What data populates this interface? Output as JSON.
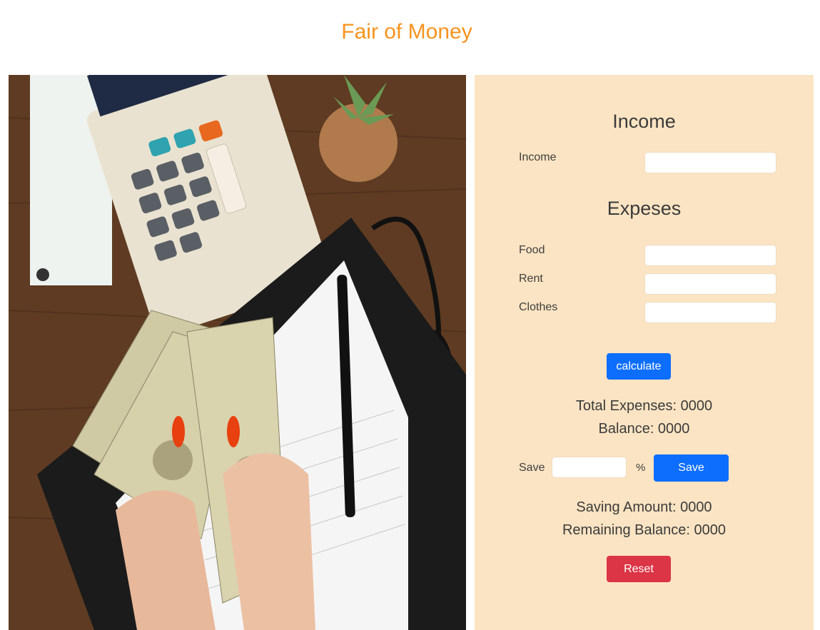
{
  "header": {
    "title": "Fair of Money"
  },
  "photo": {
    "alt": "Hands holding dollar bills over a desk with a calculator, notebook, pen and glasses"
  },
  "panel": {
    "income_heading": "Income",
    "income_label": "Income",
    "income_value": "",
    "expenses_heading": "Expeses",
    "food_label": "Food",
    "food_value": "",
    "rent_label": "Rent",
    "rent_value": "",
    "clothes_label": "Clothes",
    "clothes_value": "",
    "calculate_label": "calculate",
    "total_expenses": "Total Expenses: 0000",
    "balance": "Balance: 0000",
    "save_label": "Save",
    "save_value": "",
    "percent_sign": "%",
    "save_button": "Save",
    "saving_amount": "Saving Amount: 0000",
    "remaining_balance": "Remaining Balance: 0000",
    "reset_label": "Reset"
  },
  "colors": {
    "title": "#f7931e",
    "panel_bg": "#fbe4c3",
    "primary": "#0d6efd",
    "danger": "#dc3545"
  }
}
